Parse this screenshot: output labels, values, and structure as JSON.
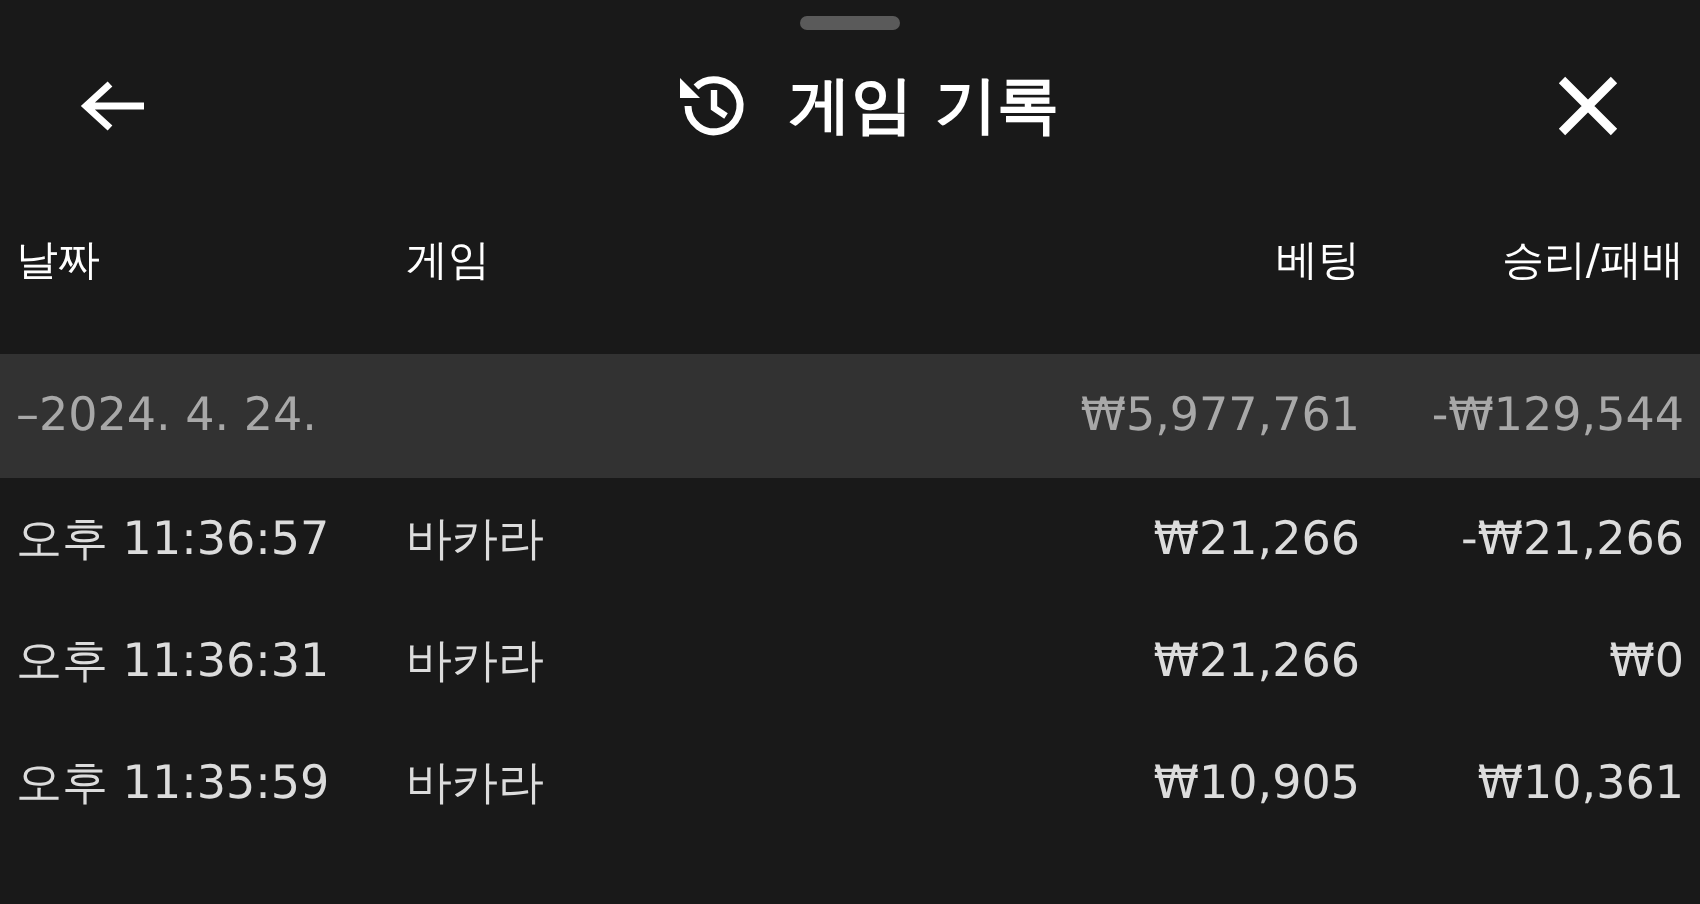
{
  "header": {
    "title": "게임 기록"
  },
  "table": {
    "columns": [
      "날짜",
      "게임",
      "베팅",
      "승리/패배"
    ],
    "groups": [
      {
        "date": "–2024. 4. 24.",
        "bet": "₩5,977,761",
        "result": "-₩129,544",
        "rows": [
          {
            "time": "오후 11:36:57",
            "game": "바카라",
            "bet": "₩21,266",
            "result": "-₩21,266"
          },
          {
            "time": "오후 11:36:31",
            "game": "바카라",
            "bet": "₩21,266",
            "result": "₩0"
          },
          {
            "time": "오후 11:35:59",
            "game": "바카라",
            "bet": "₩10,905",
            "result": "₩10,361"
          }
        ]
      }
    ]
  }
}
